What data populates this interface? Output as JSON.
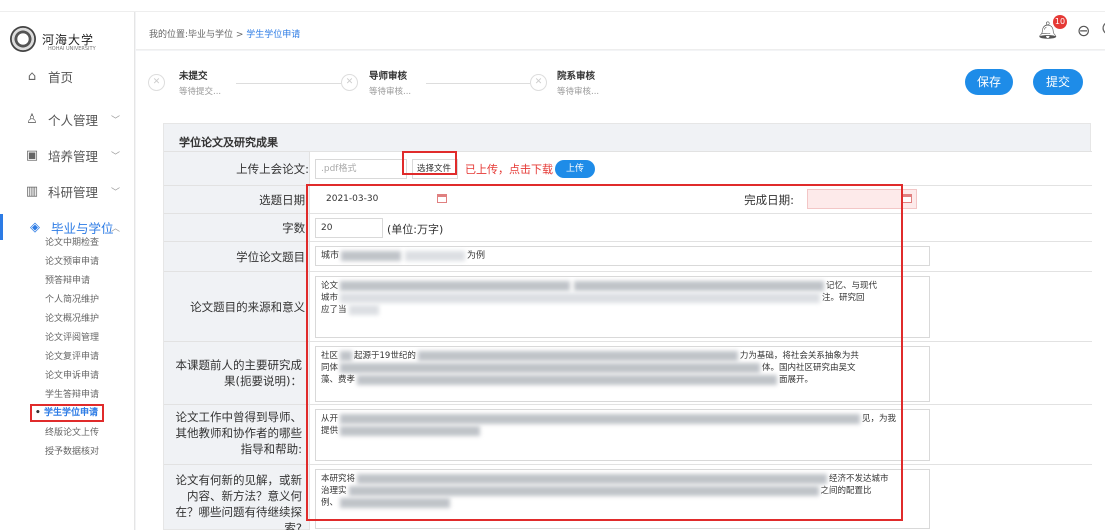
{
  "logo": {
    "name": "河海大学",
    "sub": "HOHAI UNIVERSITY"
  },
  "breadcrumb": {
    "prefix": "我的位置:毕业与学位 > ",
    "current": "学生学位申请"
  },
  "header": {
    "notifications": "10"
  },
  "menu": {
    "home": "首页",
    "personal": "个人管理",
    "training": "培养管理",
    "research": "科研管理",
    "graduation": "毕业与学位",
    "sub": [
      "论文中期检查",
      "论文预审申请",
      "预答辩申请",
      "个人简况维护",
      "论文概况维护",
      "论文评阅管理",
      "论文复评申请",
      "论文申诉申请",
      "学生答辩申请",
      "学生学位申请",
      "终版论文上传",
      "授予数据核对"
    ]
  },
  "steps": [
    {
      "title": "未提交",
      "sub": "等待提交..."
    },
    {
      "title": "导师审核",
      "sub": "等待审核..."
    },
    {
      "title": "院系审核",
      "sub": "等待审核..."
    }
  ],
  "buttons": {
    "save": "保存",
    "submit": "提交"
  },
  "form": {
    "section_title": "学位论文及研究成果",
    "upload_label": "上传上会论文:",
    "upload_placeholder": ".pdf格式",
    "choose_file": "选择文件",
    "uploaded_text": "已上传，点击下载",
    "upload_button": "上传",
    "topic_date_label": "选题日期:",
    "topic_date_value": "2021-03-30",
    "finish_date_label": "完成日期:",
    "words_label": "字数:",
    "words_value": "20",
    "words_unit": "(单位:万字)",
    "thesis_title_label": "学位论文题目:",
    "thesis_title_start": "城市",
    "thesis_title_end": "为例",
    "source_label": "论文题目的来源和意义:",
    "source_text_a": "论文",
    "source_text_b": "记忆、与现代",
    "source_text_c": "城市",
    "source_text_d": "注。研究回",
    "source_text_e": "应了当",
    "predecessors_label": "本课题前人的主要研究成果(扼要说明)：",
    "predecessors_text_a": "社区",
    "predecessors_text_b": "起源于19世纪的",
    "predecessors_text_c": "力为基础，将社会关系抽象为共",
    "predecessors_text_d": "同体",
    "predecessors_text_e": "体。国内社区研究由吴文",
    "predecessors_text_f": "藻、费孝",
    "predecessors_text_g": "面展开。",
    "help_label": "论文工作中曾得到导师、其他教师和协作者的哪些指导和帮助:",
    "help_text_a": "从开",
    "help_text_b": "见，为我",
    "help_text_c": "提供",
    "innovation_label": "论文有何新的见解，或新内容、新方法？意义何在？哪些问题有待继续探索?",
    "innovation_text_a": "本研究将",
    "innovation_text_b": "经济不发达城市",
    "innovation_text_c": "治理实",
    "innovation_text_d": "之间的配置比",
    "innovation_text_e": "例、"
  }
}
